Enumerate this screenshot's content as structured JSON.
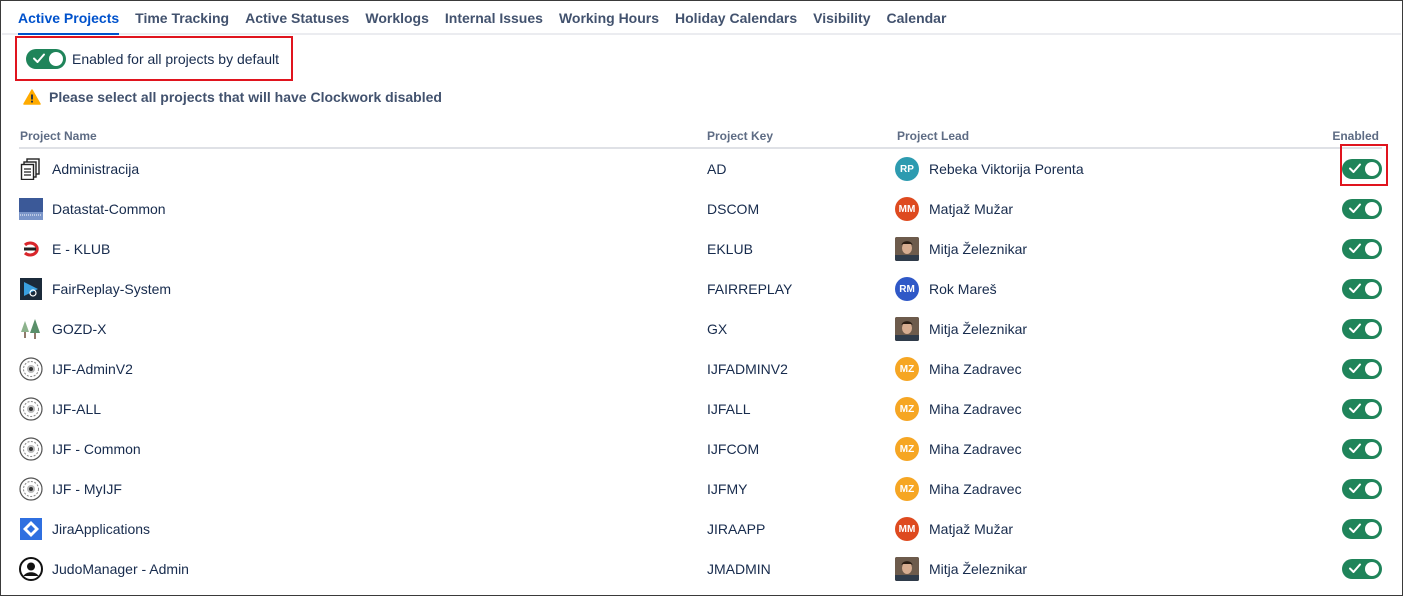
{
  "tabs": [
    {
      "label": "Active Projects",
      "active": true
    },
    {
      "label": "Time Tracking"
    },
    {
      "label": "Active Statuses"
    },
    {
      "label": "Worklogs"
    },
    {
      "label": "Internal Issues"
    },
    {
      "label": "Working Hours"
    },
    {
      "label": "Holiday Calendars"
    },
    {
      "label": "Visibility"
    },
    {
      "label": "Calendar"
    }
  ],
  "default_toggle": {
    "label": "Enabled for all projects by default",
    "on": true
  },
  "warning": {
    "text": "Please select all projects that will have Clockwork disabled",
    "icon": "warning-icon"
  },
  "columns": {
    "name": "Project Name",
    "key": "Project Key",
    "lead": "Project Lead",
    "enabled": "Enabled"
  },
  "colors": {
    "accent": "#0052cc",
    "toggle_on": "#1f845a",
    "highlight": "#e0141e",
    "warning": "#ffab00"
  },
  "projects": [
    {
      "name": "Administracija",
      "key": "AD",
      "icon": "documents-icon",
      "lead": "Rebeka Viktorija Porenta",
      "initials": "RP",
      "avatar_color": "#2d9bb0",
      "enabled": true
    },
    {
      "name": "Datastat-Common",
      "key": "DSCOM",
      "icon": "datastat-icon",
      "lead": "Matjaž Mužar",
      "initials": "MM",
      "avatar_color": "#de4a1f",
      "enabled": true
    },
    {
      "name": "E - KLUB",
      "key": "EKLUB",
      "icon": "eklub-icon",
      "lead": "Mitja Železnikar",
      "initials": "",
      "avatar_color": "photo",
      "enabled": true
    },
    {
      "name": "FairReplay-System",
      "key": "FAIRREPLAY",
      "icon": "fairreplay-icon",
      "lead": "Rok Mareš",
      "initials": "RM",
      "avatar_color": "#2f58c7",
      "enabled": true
    },
    {
      "name": "GOZD-X",
      "key": "GX",
      "icon": "trees-icon",
      "lead": "Mitja Železnikar",
      "initials": "",
      "avatar_color": "photo",
      "enabled": true
    },
    {
      "name": "IJF-AdminV2",
      "key": "IJFADMINV2",
      "icon": "ijf-emblem-icon",
      "lead": "Miha Zadravec",
      "initials": "MZ",
      "avatar_color": "#f6a623",
      "enabled": true
    },
    {
      "name": "IJF-ALL",
      "key": "IJFALL",
      "icon": "ijf-emblem-icon",
      "lead": "Miha Zadravec",
      "initials": "MZ",
      "avatar_color": "#f6a623",
      "enabled": true
    },
    {
      "name": "IJF - Common",
      "key": "IJFCOM",
      "icon": "ijf-emblem-icon",
      "lead": "Miha Zadravec",
      "initials": "MZ",
      "avatar_color": "#f6a623",
      "enabled": true
    },
    {
      "name": "IJF - MyIJF",
      "key": "IJFMY",
      "icon": "ijf-emblem-icon",
      "lead": "Miha Zadravec",
      "initials": "MZ",
      "avatar_color": "#f6a623",
      "enabled": true
    },
    {
      "name": "JiraApplications",
      "key": "JIRAAPP",
      "icon": "jira-icon",
      "lead": "Matjaž Mužar",
      "initials": "MM",
      "avatar_color": "#de4a1f",
      "enabled": true
    },
    {
      "name": "JudoManager - Admin",
      "key": "JMADMIN",
      "icon": "user-circle-icon",
      "lead": "Mitja Železnikar",
      "initials": "",
      "avatar_color": "photo",
      "enabled": true
    }
  ]
}
